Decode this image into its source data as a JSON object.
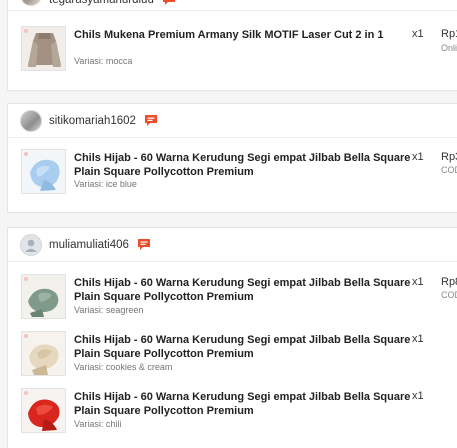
{
  "orders": [
    {
      "username": "tegarusyamanurdiuu",
      "items": [
        {
          "title": "Chils Mukena Premium Armany Silk MOTIF Laser Cut 2 in 1",
          "variant": "Variasi: mocca",
          "qty": "x1",
          "price": "Rp1",
          "payment": "Onli"
        }
      ]
    },
    {
      "username": "sitikomariah1602",
      "items": [
        {
          "title": "Chils Hijab - 60 Warna Kerudung Segi empat Jilbab Bella Square Plain Square Pollycotton Premium",
          "variant": "Variasi: ice blue",
          "qty": "x1",
          "price": "Rp3",
          "payment": "COD"
        }
      ]
    },
    {
      "username": "muliamuliati406",
      "items": [
        {
          "title": "Chils Hijab - 60 Warna Kerudung Segi empat Jilbab Bella Square Plain Square Pollycotton Premium",
          "variant": "Variasi: seagreen",
          "qty": "x1",
          "price": "Rp8",
          "payment": "COD"
        },
        {
          "title": "Chils Hijab - 60 Warna Kerudung Segi empat Jilbab Bella Square Plain Square Pollycotton Premium",
          "variant": "Variasi: cookies & cream",
          "qty": "x1",
          "price": "",
          "payment": ""
        },
        {
          "title": "Chils Hijab - 60 Warna Kerudung Segi empat Jilbab Bella Square Plain Square Pollycotton Premium",
          "variant": "Variasi: chili",
          "qty": "x1",
          "price": "",
          "payment": ""
        }
      ]
    }
  ],
  "colors": {
    "chat_icon": "#ee4d2d",
    "product_mocca": "#a39283",
    "product_iceblue": "#a9cdef",
    "product_seagreen": "#7f9a88",
    "product_cookies": "#e6d7bf",
    "product_chili": "#d8261f"
  },
  "icons": {
    "chat": "chat-icon",
    "default_avatar": "user-avatar-icon"
  }
}
